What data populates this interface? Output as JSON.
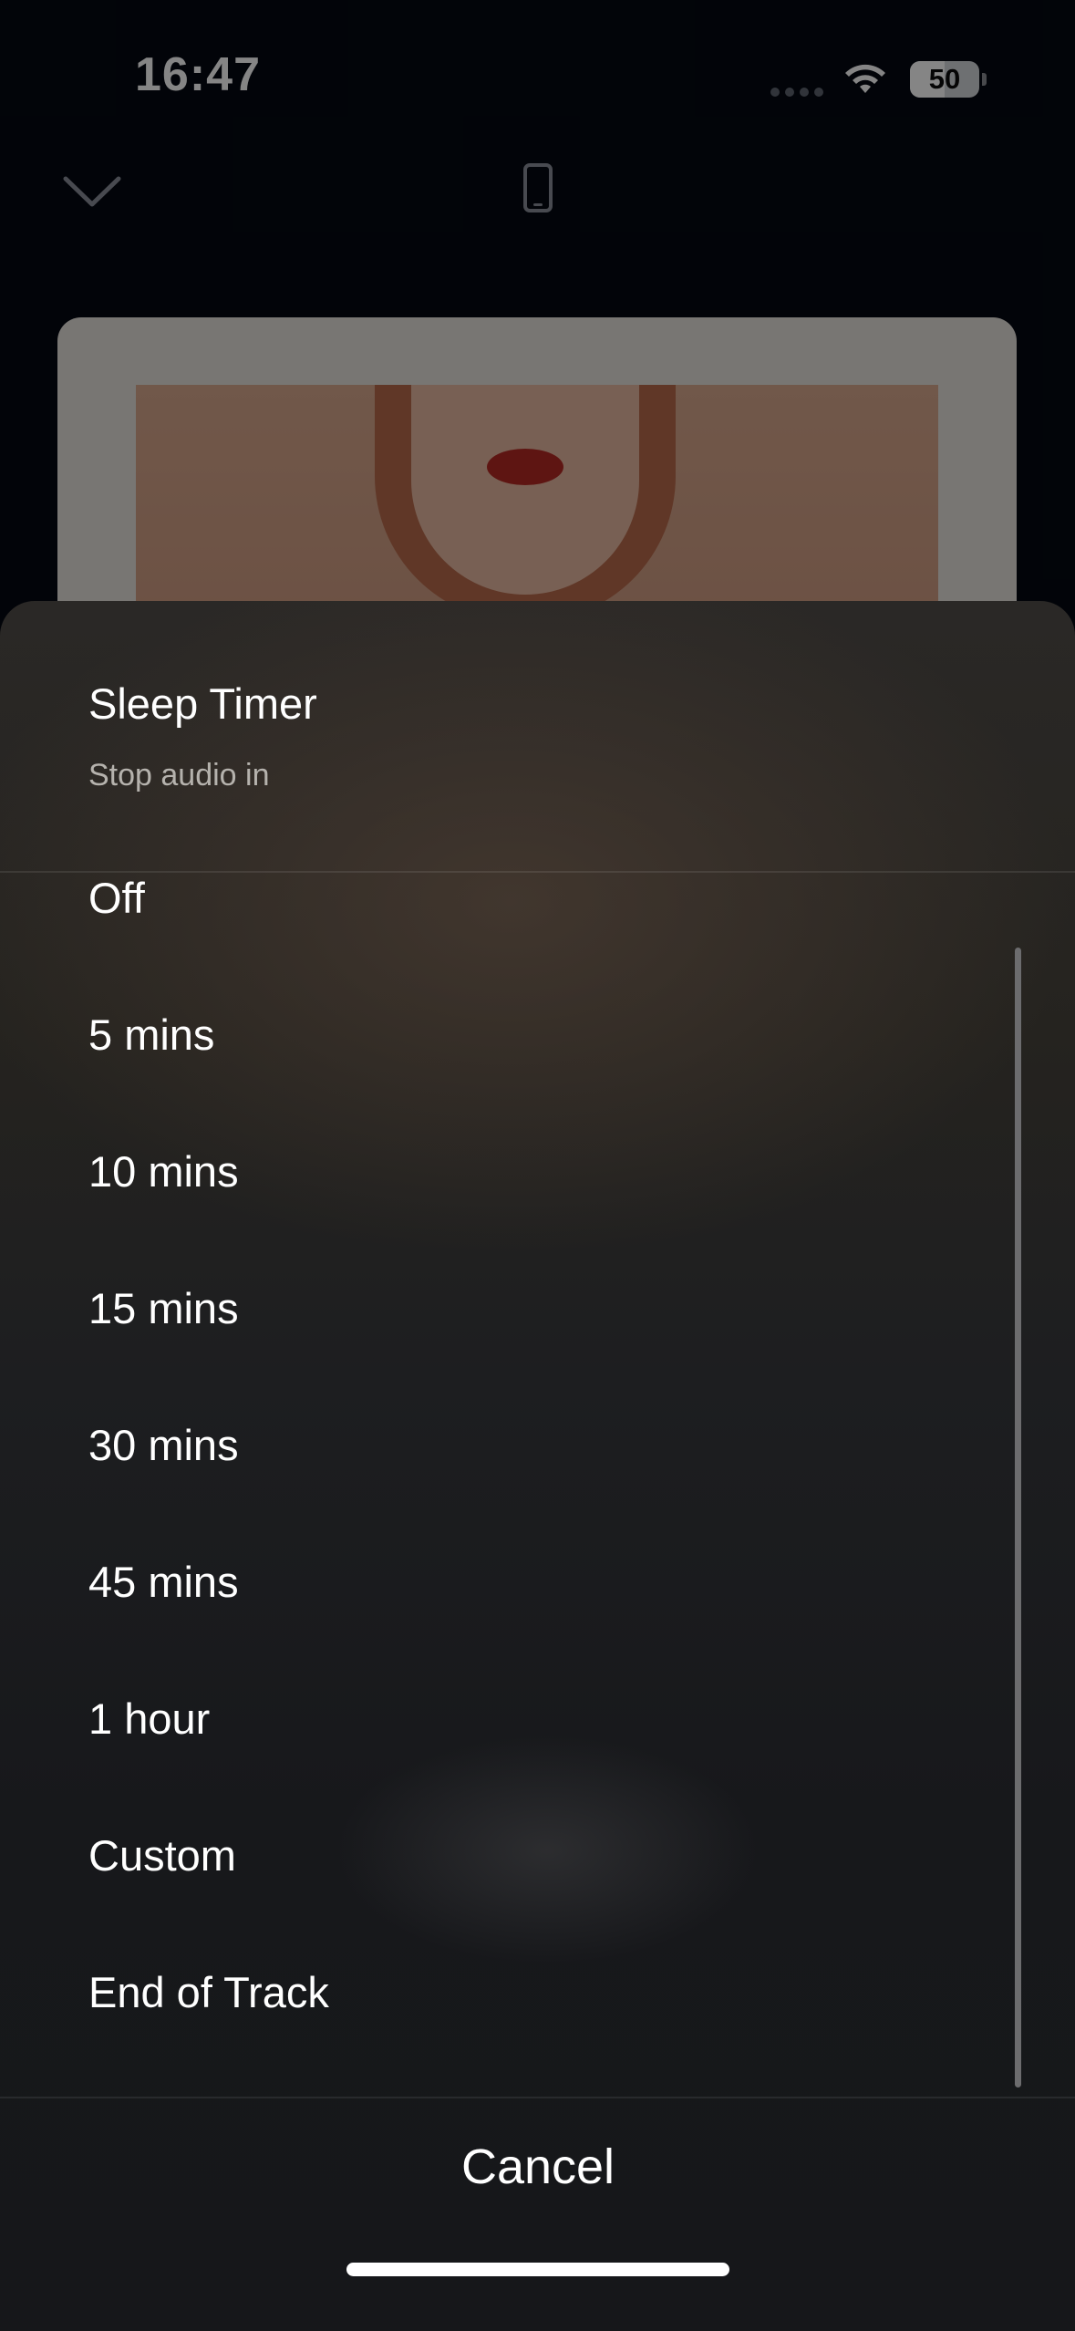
{
  "status_bar": {
    "time": "16:47",
    "battery_percent": "50",
    "battery_level": 0.5,
    "icons": [
      "signal-dots-icon",
      "wifi-icon",
      "battery-icon"
    ]
  },
  "player_header": {
    "icons": [
      "chevron-down-icon",
      "phone-device-icon"
    ]
  },
  "sheet": {
    "title": "Sleep Timer",
    "subtitle": "Stop audio in",
    "options": [
      "Off",
      "5 mins",
      "10 mins",
      "15 mins",
      "30 mins",
      "45 mins",
      "1 hour",
      "Custom",
      "End of Track"
    ],
    "cancel_label": "Cancel"
  },
  "colors": {
    "background": "#040912",
    "sheet_top": "#2a2826",
    "sheet_bottom": "#16171a",
    "subtitle_text": "#b5b2ad",
    "text": "#ffffff"
  }
}
